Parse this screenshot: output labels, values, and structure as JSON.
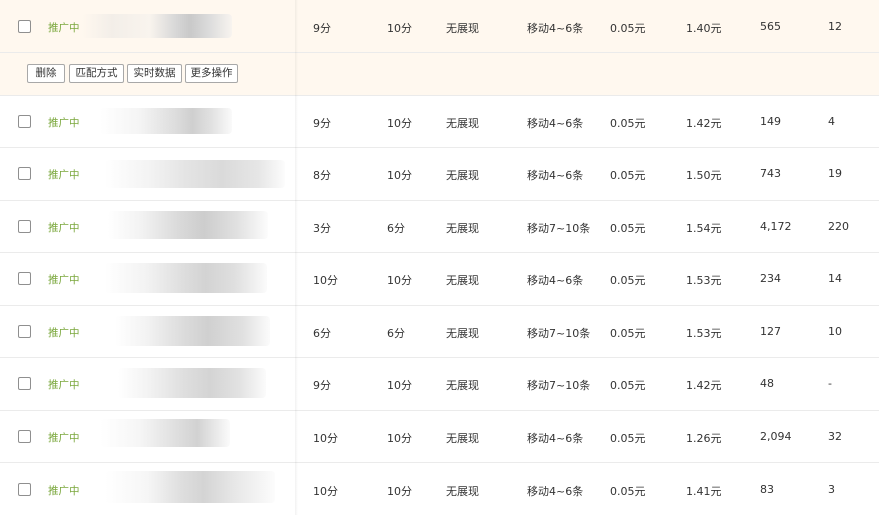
{
  "actions": {
    "delete": "删除",
    "match_mode": "匹配方式",
    "realtime_data": "实时数据",
    "more_actions": "更多操作"
  },
  "rows": [
    {
      "status": "推广中",
      "score1": "9分",
      "score2": "10分",
      "show": "无展现",
      "position": "移动4~6条",
      "min_bid": "0.05元",
      "price": "1.40元",
      "impressions": "565",
      "clicks": "12"
    },
    {
      "status": "推广中",
      "score1": "9分",
      "score2": "10分",
      "show": "无展现",
      "position": "移动4~6条",
      "min_bid": "0.05元",
      "price": "1.42元",
      "impressions": "149",
      "clicks": "4"
    },
    {
      "status": "推广中",
      "score1": "8分",
      "score2": "10分",
      "show": "无展现",
      "position": "移动4~6条",
      "min_bid": "0.05元",
      "price": "1.50元",
      "impressions": "743",
      "clicks": "19"
    },
    {
      "status": "推广中",
      "score1": "3分",
      "score2": "6分",
      "show": "无展现",
      "position": "移动7~10条",
      "min_bid": "0.05元",
      "price": "1.54元",
      "impressions": "4,172",
      "clicks": "220"
    },
    {
      "status": "推广中",
      "score1": "10分",
      "score2": "10分",
      "show": "无展现",
      "position": "移动4~6条",
      "min_bid": "0.05元",
      "price": "1.53元",
      "impressions": "234",
      "clicks": "14"
    },
    {
      "status": "推广中",
      "score1": "6分",
      "score2": "6分",
      "show": "无展现",
      "position": "移动7~10条",
      "min_bid": "0.05元",
      "price": "1.53元",
      "impressions": "127",
      "clicks": "10"
    },
    {
      "status": "推广中",
      "score1": "9分",
      "score2": "10分",
      "show": "无展现",
      "position": "移动7~10条",
      "min_bid": "0.05元",
      "price": "1.42元",
      "impressions": "48",
      "clicks": "-"
    },
    {
      "status": "推广中",
      "score1": "10分",
      "score2": "10分",
      "show": "无展现",
      "position": "移动4~6条",
      "min_bid": "0.05元",
      "price": "1.26元",
      "impressions": "2,094",
      "clicks": "32"
    },
    {
      "status": "推广中",
      "score1": "10分",
      "score2": "10分",
      "show": "无展现",
      "position": "移动4~6条",
      "min_bid": "0.05元",
      "price": "1.41元",
      "impressions": "83",
      "clicks": "3"
    }
  ]
}
